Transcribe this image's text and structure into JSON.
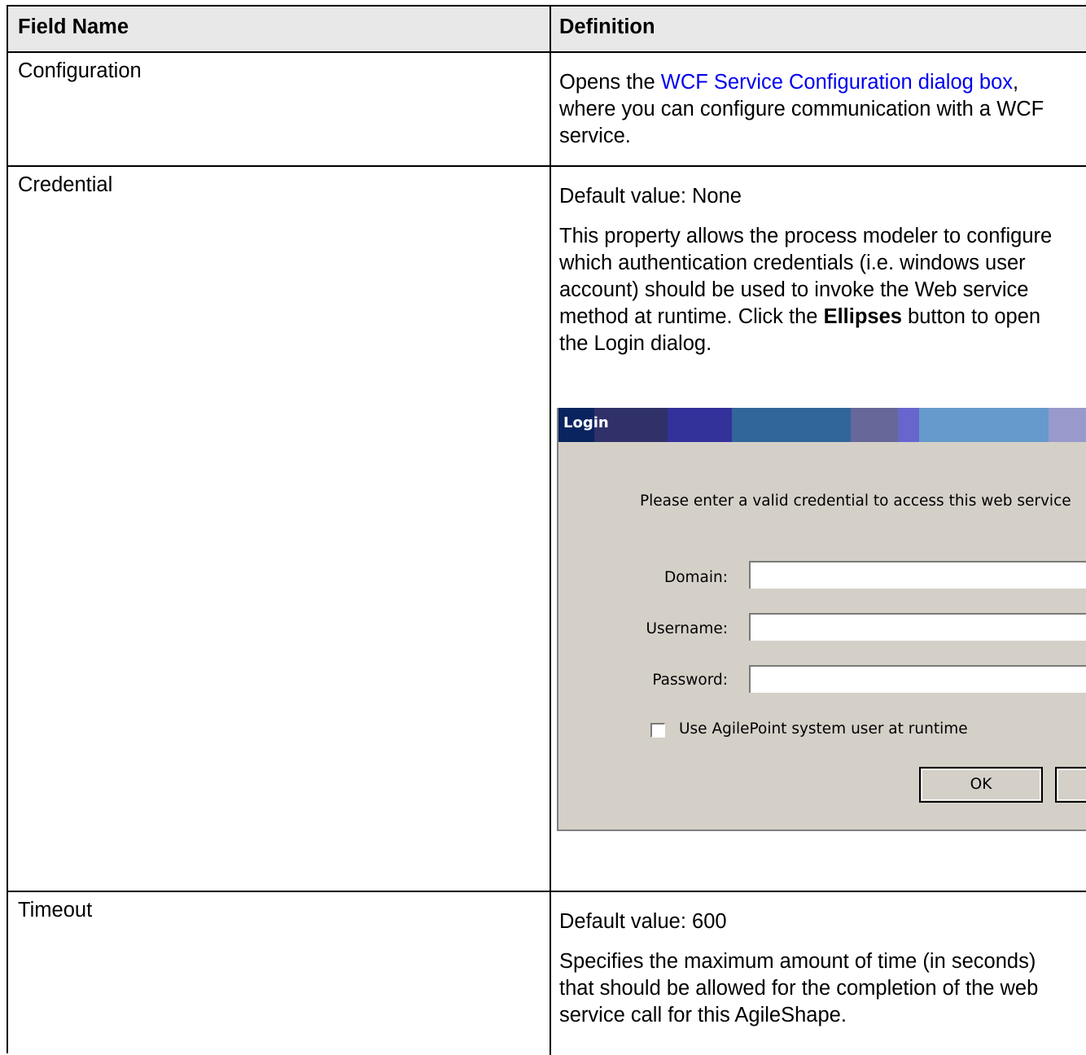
{
  "table": {
    "headers": {
      "field_name": "Field Name",
      "definition": "Definition"
    },
    "rows": [
      {
        "field": "Configuration",
        "def_prefix": "Opens the ",
        "def_link": "WCF Service Configuration dialog box",
        "def_suffix": ", where you can configure communication with a WCF service."
      },
      {
        "field": "Credential",
        "default": "Default value: None",
        "desc": "This property allows the process modeler to configure which authentication credentials (i.e. windows user account) should be used to invoke the Web service method at runtime. Click the",
        "desc_bold": "Ellipses",
        "desc_tail": " button to open the Login dialog."
      },
      {
        "field": "Timeout",
        "default": "Default value: 600",
        "desc": "Specifies the maximum amount of time (in seconds) that should be allowed for the completion of the web service call for this AgileShape."
      }
    ]
  },
  "login_dialog": {
    "title": "Login",
    "message": "Please enter a valid credential to access this web service",
    "domain_label": "Domain:",
    "username_label": "Username:",
    "password_label": "Password:",
    "domain_value": "",
    "username_value": "",
    "password_value": "",
    "checkbox_label": "Use AgilePoint system user at runtime",
    "checkbox_checked": false,
    "ok_label": "OK",
    "cancel_label": "",
    "titlebar_colors": [
      "#0a2460",
      "#2f3168",
      "#33319a",
      "#31669a",
      "#676799",
      "#6866cd",
      "#6699cc",
      "#9a99cc"
    ]
  }
}
